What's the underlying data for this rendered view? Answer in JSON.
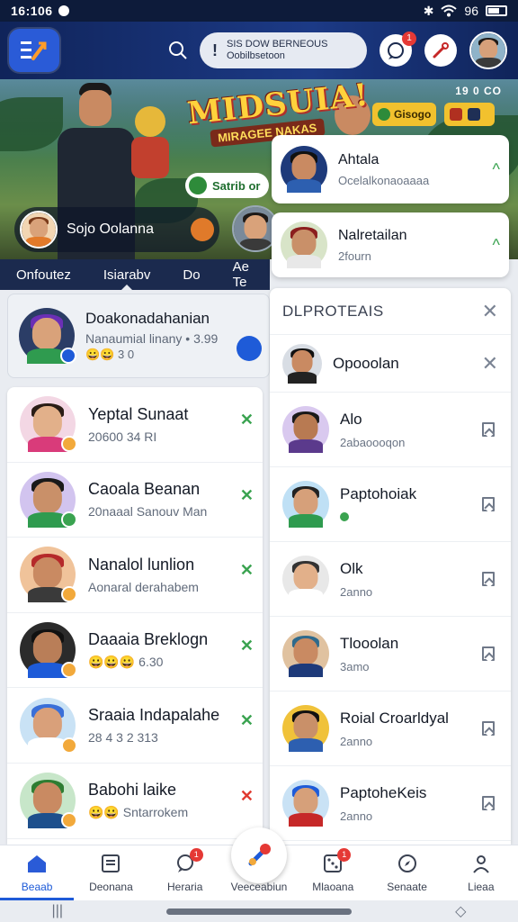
{
  "status_bar": {
    "time": "16:106",
    "battery": "96"
  },
  "header": {
    "search_line1": "SIS DOW BERNEOUS",
    "search_line2": "Oobilbsetoon",
    "notif_badge": "1"
  },
  "banner": {
    "title": "MIDSUIA!",
    "subtitle": "MIRAGEE NAKAS",
    "corner_text": "19 0 CO",
    "chip_left": "Gisogo",
    "chip_right": "",
    "cta_label": "Satrib or",
    "user_name": "Sojo Oolanna"
  },
  "tabs": [
    {
      "label": "Onfoutez"
    },
    {
      "label": "Isiarabv"
    },
    {
      "label": "Do"
    },
    {
      "label": "Ae Te"
    }
  ],
  "featured": {
    "title": "Doakonadahanian",
    "subtitle": "Nanaumial linany • 3.99",
    "meta": "😀😀 3 0"
  },
  "left_list": [
    {
      "name": "Yeptal Sunaat",
      "sub": "20600 34 RI",
      "action": "✕",
      "tone": "green",
      "face": "#e2b08a",
      "hair": "#2a1d16",
      "shirt": "#d93b7a",
      "bg": "#f3d7e4",
      "mini": "#f2a93b"
    },
    {
      "name": "Caoala Beanan",
      "sub": "20naaal Sanouv Man",
      "action": "✕",
      "tone": "green",
      "face": "#c99069",
      "hair": "#1a1a1a",
      "shirt": "#2f9b4f",
      "bg": "#d2c4ef",
      "mini": "#3aa350"
    },
    {
      "name": "Nanalol lunlion",
      "sub": "Aonaral derahabem",
      "action": "✕",
      "tone": "green",
      "face": "#c98a62",
      "hair": "#b52a2a",
      "shirt": "#3a3a3a",
      "bg": "#f0c39a",
      "mini": "#f2a93b"
    },
    {
      "name": "Daaaia Breklogn",
      "sub": "😀😀😀 6.30",
      "action": "✕",
      "tone": "green",
      "face": "#b97e58",
      "hair": "#111111",
      "shirt": "#1e5bd8",
      "bg": "#2b2b2b",
      "mini": "#f2a93b"
    },
    {
      "name": "Sraaia Indapalahe",
      "sub": "28 4 3 2 313",
      "action": "✕",
      "tone": "green",
      "face": "#d9a07a",
      "hair": "#3a6fd8",
      "shirt": "#ffffff",
      "bg": "#c9e2f5",
      "mini": "#f2a93b"
    },
    {
      "name": "Babohi laike",
      "sub": "😀😀 Sntarrokem",
      "action": "✕",
      "tone": "red",
      "face": "#c98a62",
      "hair": "#2e7d32",
      "shirt": "#1d4f8c",
      "bg": "#c7e6c9",
      "mini": "#f2a93b"
    }
  ],
  "notifications": [
    {
      "name": "Ahtala",
      "sub": "Ocelalkonaoaaaa",
      "face": "#c98a62",
      "hair": "#111",
      "shirt": "#2d5fb0",
      "bg": "#1e3a7a"
    },
    {
      "name": "Nalretailan",
      "sub": "2fourn",
      "face": "#c99069",
      "hair": "#8b1e1e",
      "shirt": "#e8e8e8",
      "bg": "#d8e4c8"
    }
  ],
  "panel": {
    "title": "DLPROTEAIS",
    "items": [
      {
        "name": "Opooolan",
        "sub": "",
        "end": "x",
        "face": "#c98a62",
        "hair": "#111",
        "shirt": "#222",
        "bg": "#d8dde4"
      },
      {
        "name": "Alo",
        "sub": "2abaoooqon",
        "end": "bm",
        "face": "#b87a52",
        "hair": "#1a1a1a",
        "shirt": "#5b3a8c",
        "bg": "#d9c9ef"
      },
      {
        "name": "Paptohoiak",
        "sub": "",
        "end": "bm",
        "face": "#d6a07a",
        "hair": "#222",
        "shirt": "#2f9b4f",
        "bg": "#bfe0f5"
      },
      {
        "name": "Olk",
        "sub": "2anno",
        "end": "bm",
        "face": "#e2b08a",
        "hair": "#333",
        "shirt": "#fff",
        "bg": "#e8e8e8"
      },
      {
        "name": "Tlooolan",
        "sub": "3amo",
        "end": "bm",
        "face": "#c98a62",
        "hair": "#2f6a8c",
        "shirt": "#1e3a7a",
        "bg": "#e0c2a0"
      },
      {
        "name": "Roial Croarldyal",
        "sub": "2anno",
        "end": "bm",
        "face": "#c99069",
        "hair": "#111",
        "shirt": "#2d5fb0",
        "bg": "#f0c23a"
      },
      {
        "name": "PaptoheKeis",
        "sub": "2anno",
        "end": "bm",
        "face": "#d6a07a",
        "hair": "#1e5bd8",
        "shirt": "#c62828",
        "bg": "#c9e2f5"
      }
    ]
  },
  "bottom_nav": [
    {
      "label": "Beaab",
      "icon": "home-icon",
      "badge": ""
    },
    {
      "label": "Deonana",
      "icon": "document-icon",
      "badge": ""
    },
    {
      "label": "Heraria",
      "icon": "chat-icon",
      "badge": "1"
    },
    {
      "label": "Veeceabiun",
      "icon": "",
      "badge": ""
    },
    {
      "label": "Mlaoana",
      "icon": "dice-icon",
      "badge": "1"
    },
    {
      "label": "Senaate",
      "icon": "compass-icon",
      "badge": ""
    },
    {
      "label": "Lieaa",
      "icon": "user-icon",
      "badge": ""
    }
  ],
  "colors": {
    "accent": "#1e5bd8",
    "header": "#10245a",
    "positive": "#3aa350",
    "negative": "#e0392f",
    "badge": "#e53935"
  }
}
